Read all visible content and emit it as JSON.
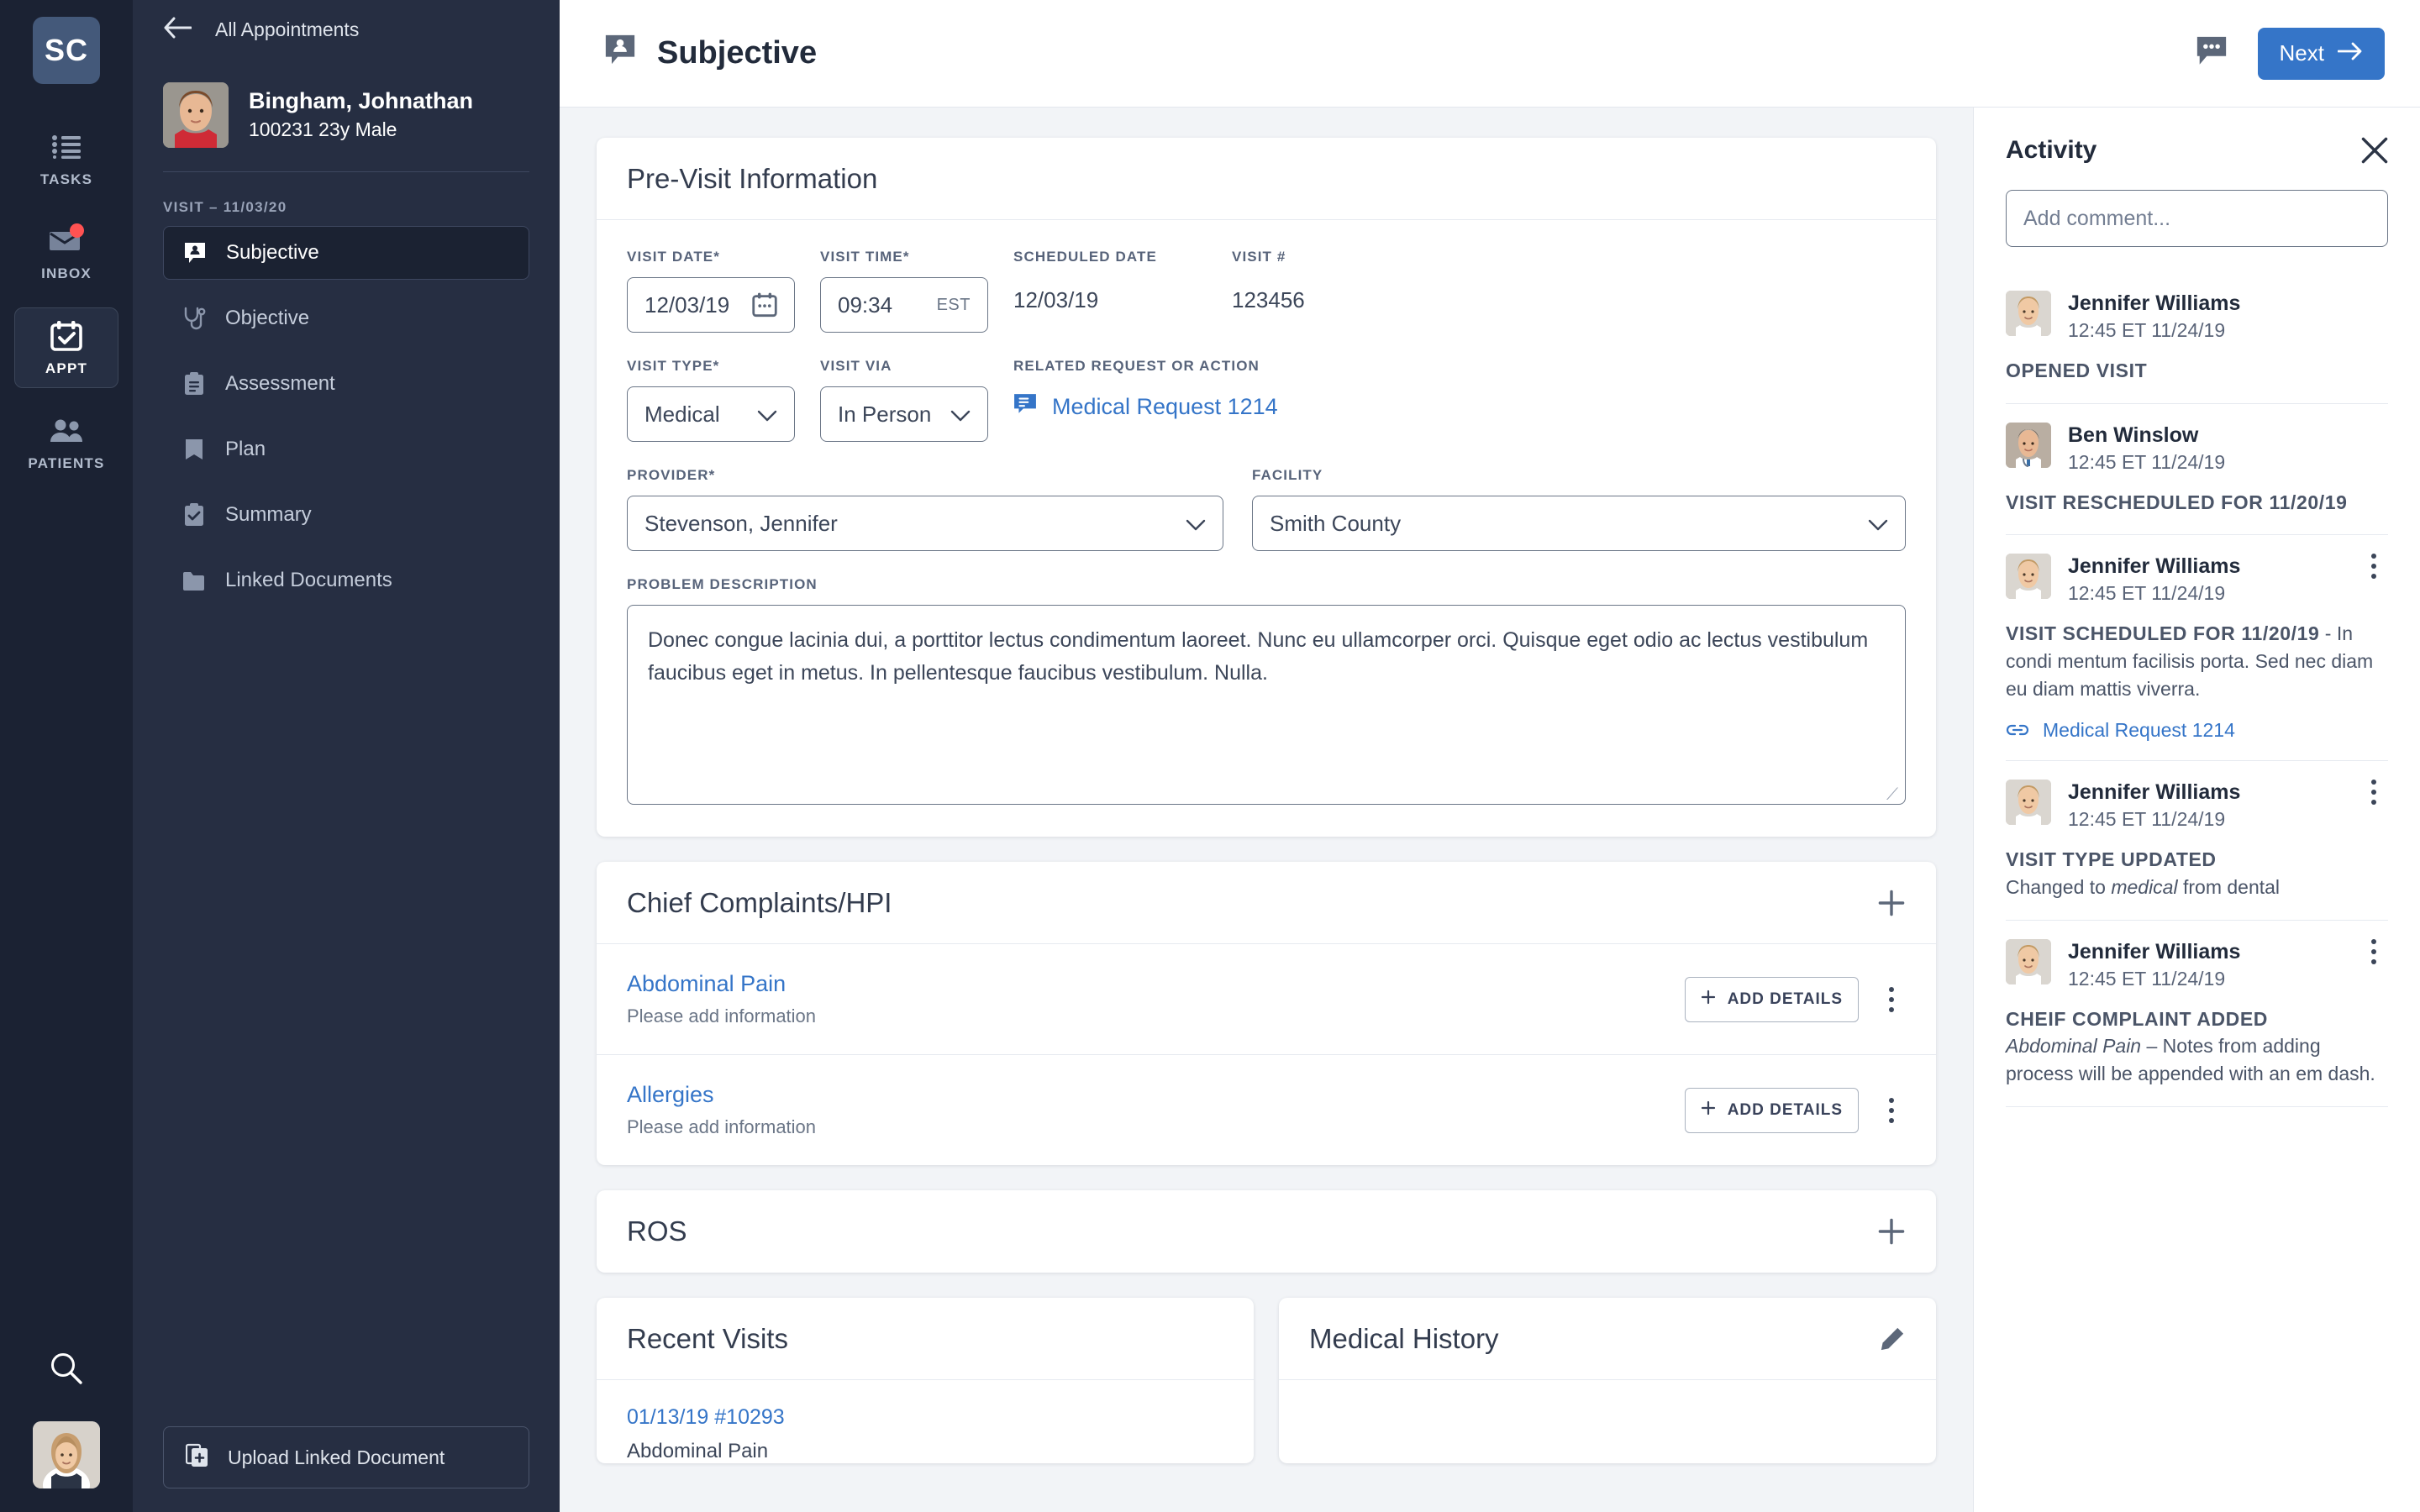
{
  "rail": {
    "logo": "SC",
    "items": [
      {
        "label": "TASKS",
        "icon": "list-icon",
        "active": false,
        "badge": false
      },
      {
        "label": "INBOX",
        "icon": "envelope-icon",
        "active": false,
        "badge": true
      },
      {
        "label": "APPT",
        "icon": "calendar-check-icon",
        "active": true,
        "badge": false
      },
      {
        "label": "PATIENTS",
        "icon": "people-icon",
        "active": false,
        "badge": false
      }
    ],
    "search_icon": "search-icon",
    "user_avatar": "user-avatar"
  },
  "sidebar": {
    "back_label": "All Appointments",
    "patient": {
      "name": "Bingham, Johnathan",
      "meta": "100231 23y Male"
    },
    "visit_label": "VISIT – 11/03/20",
    "nav": [
      {
        "label": "Subjective",
        "icon": "speech-person-icon",
        "active": true
      },
      {
        "label": "Objective",
        "icon": "stethoscope-icon",
        "active": false
      },
      {
        "label": "Assessment",
        "icon": "clipboard-icon",
        "active": false
      },
      {
        "label": "Plan",
        "icon": "book-icon",
        "active": false
      },
      {
        "label": "Summary",
        "icon": "clipboard-check-icon",
        "active": false
      },
      {
        "label": "Linked Documents",
        "icon": "folder-icon",
        "active": false
      }
    ],
    "upload_label": "Upload Linked Document",
    "upload_icon": "document-add-icon"
  },
  "topbar": {
    "title": "Subjective",
    "title_icon": "speech-person-icon",
    "comment_icon": "comment-icon",
    "next_label": "Next",
    "next_icon": "arrow-right-icon"
  },
  "previsit": {
    "title": "Pre-Visit Information",
    "visit_date": {
      "label": "VISIT DATE*",
      "value": "12/03/19",
      "icon": "calendar-icon"
    },
    "visit_time": {
      "label": "VISIT TIME*",
      "value": "09:34",
      "suffix": "EST"
    },
    "scheduled_date": {
      "label": "SCHEDULED DATE",
      "value": "12/03/19"
    },
    "visit_number": {
      "label": "VISIT #",
      "value": "123456"
    },
    "visit_type": {
      "label": "VISIT TYPE*",
      "value": "Medical"
    },
    "visit_via": {
      "label": "VISIT VIA",
      "value": "In Person"
    },
    "related_request": {
      "label": "RELATED REQUEST OR ACTION",
      "value": "Medical Request 1214",
      "icon": "request-icon"
    },
    "provider": {
      "label": "PROVIDER*",
      "value": "Stevenson, Jennifer"
    },
    "facility": {
      "label": "FACILITY",
      "value": "Smith County"
    },
    "problem_description": {
      "label": "PROBLEM DESCRIPTION",
      "value": "Donec congue lacinia dui, a porttitor lectus condimentum laoreet. Nunc eu ullamcorper orci. Quisque eget odio ac lectus vestibulum faucibus eget in metus. In pellentesque faucibus vestibulum. Nulla."
    }
  },
  "chief_complaints": {
    "title": "Chief Complaints/HPI",
    "add_icon": "plus-icon",
    "add_details_label": "ADD DETAILS",
    "items": [
      {
        "name": "Abdominal Pain",
        "sub": "Please add information"
      },
      {
        "name": "Allergies",
        "sub": "Please add information"
      }
    ]
  },
  "ros": {
    "title": "ROS",
    "add_icon": "plus-icon"
  },
  "recent_visits": {
    "title": "Recent Visits",
    "items": [
      {
        "link": "01/13/19 #10293",
        "sub": "Abdominal Pain"
      }
    ]
  },
  "medical_history": {
    "title": "Medical History",
    "edit_icon": "pencil-icon"
  },
  "activity": {
    "title": "Activity",
    "close_icon": "close-icon",
    "comment_placeholder": "Add comment...",
    "items": [
      {
        "author": "Jennifer Williams",
        "avatar": "female-avatar",
        "timestamp": "12:45 ET 11/24/19",
        "tag": "OPENED VISIT",
        "text": "",
        "link": "",
        "menu": false
      },
      {
        "author": "Ben Winslow",
        "avatar": "male-avatar",
        "timestamp": "12:45 ET 11/24/19",
        "tag": "VISIT RESCHEDULED FOR 11/20/19",
        "text": "",
        "link": "",
        "menu": false
      },
      {
        "author": "Jennifer Williams",
        "avatar": "female-avatar",
        "timestamp": "12:45 ET 11/24/19",
        "tag": "VISIT SCHEDULED FOR 11/20/19",
        "text": " - In condi mentum facilisis porta. Sed nec diam eu diam mattis viverra.",
        "link": "Medical Request 1214",
        "menu": true
      },
      {
        "author": "Jennifer Williams",
        "avatar": "female-avatar",
        "timestamp": "12:45 ET 11/24/19",
        "tag": "VISIT TYPE UPDATED",
        "text": "Changed to medical from dental",
        "text_italic_word": "medical",
        "link": "",
        "menu": true
      },
      {
        "author": "Jennifer Williams",
        "avatar": "female-avatar",
        "timestamp": "12:45 ET 11/24/19",
        "tag": "CHEIF COMPLAINT ADDED",
        "text": "Abdominal Pain – Notes from adding process will be appended with an em dash.",
        "text_italic_word": "Abdominal Pain",
        "link": "",
        "menu": true
      }
    ]
  },
  "colors": {
    "rail_bg": "#1b2233",
    "sidebar_bg": "#262e42",
    "accent_blue": "#3575c8",
    "link_blue": "#3575c8",
    "badge_red": "#ff5252",
    "page_bg": "#f2f4f7"
  }
}
